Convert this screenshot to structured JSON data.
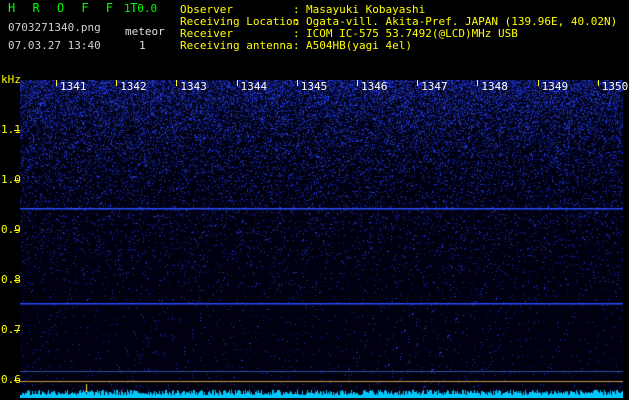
{
  "header": {
    "app_title": "H R O F F T",
    "version": "1.0.0",
    "filename": "0703271340.png",
    "timestamp": "07.03.27 13:40",
    "meteor_label": "meteor",
    "meteor_count": "1"
  },
  "station_info": [
    {
      "key": "Observer",
      "value": "Masayuki Kobayashi"
    },
    {
      "key": "Receiving Location",
      "value": "Ogata-vill. Akita-Pref. JAPAN (139.96E, 40.02N)"
    },
    {
      "key": "Receiver",
      "value": "ICOM IC-575 53.7492(@LCD)MHz USB"
    },
    {
      "key": "Receiving antenna",
      "value": "A504HB(yagi 4el)"
    }
  ],
  "separator": ":",
  "colors": {
    "title": "#00ff00",
    "info_text": "#ffff00",
    "axis": "#ffff00",
    "signal": "#2a4cff",
    "noise_floor": "#00c8ff",
    "background": "#000000"
  },
  "chart_data": {
    "type": "heatmap",
    "ylabel": "kHz",
    "x_ticks": [
      "1341",
      "1342",
      "1343",
      "1344",
      "1345",
      "1346",
      "1347",
      "1348",
      "1349",
      "1350"
    ],
    "y_ticks": [
      "1.1",
      "1.0",
      "0.9",
      "0.8",
      "0.7",
      "0.6"
    ],
    "ylim": [
      0.58,
      1.2
    ],
    "features": [
      {
        "kind": "carrier",
        "freq_khz": 0.755
      },
      {
        "kind": "carrier",
        "freq_khz": 0.945
      },
      {
        "kind": "meteor_echo",
        "time": "1341",
        "freq_khz": 0.6
      }
    ]
  }
}
